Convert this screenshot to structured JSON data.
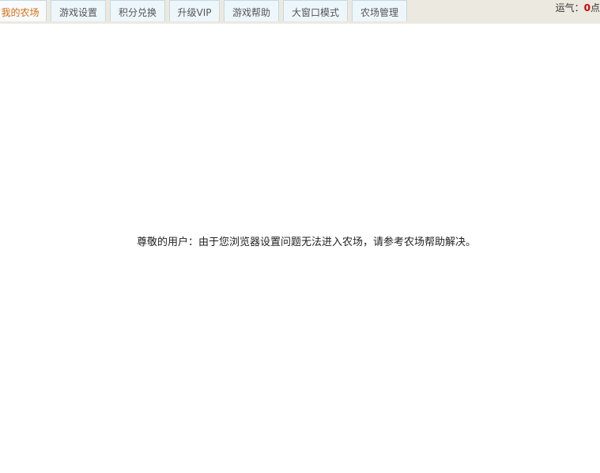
{
  "nav": {
    "tabs": [
      {
        "label": "我的农场",
        "active": true
      },
      {
        "label": "游戏设置"
      },
      {
        "label": "积分兑换"
      },
      {
        "label": "升级VIP"
      },
      {
        "label": "游戏帮助"
      },
      {
        "label": "大窗口模式"
      },
      {
        "label": "农场管理"
      }
    ]
  },
  "luck": {
    "label": "运气：",
    "value": "0",
    "unit": "点"
  },
  "main": {
    "message": "尊敬的用户：由于您浏览器设置问题无法进入农场，请参考农场帮助解决。"
  },
  "colors": {
    "active_tab_text": "#d96b0a",
    "luck_value": "#cc0000"
  }
}
